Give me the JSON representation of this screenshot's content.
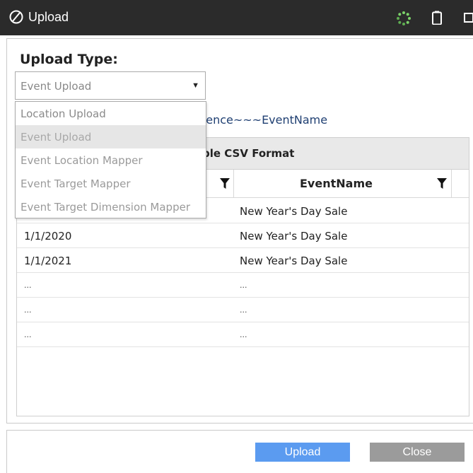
{
  "window": {
    "title": "Upload"
  },
  "form": {
    "upload_type_label": "Upload Type:",
    "selected_value": "Event Upload",
    "hint_text": "rence~~~EventName"
  },
  "dropdown": {
    "options": [
      "Location Upload",
      "Event Upload",
      "Event Location Mapper",
      "Event Target Mapper",
      "Event Target Dimension Mapper"
    ],
    "highlighted_index": 1
  },
  "table": {
    "caption": "ple CSV Format",
    "columns": [
      "",
      "EventName"
    ],
    "rows": [
      [
        "",
        "New Year's Day Sale"
      ],
      [
        "1/1/2020",
        "New Year's Day Sale"
      ],
      [
        "1/1/2021",
        "New Year's Day Sale"
      ],
      [
        "...",
        "..."
      ],
      [
        "...",
        "..."
      ],
      [
        "...",
        "..."
      ]
    ]
  },
  "footer": {
    "upload_label": "Upload",
    "close_label": "Close"
  },
  "colors": {
    "titlebar": "#2b2b2b",
    "upload_button": "#5b9bf0",
    "close_button": "#9b9b9b"
  },
  "icons": [
    "upload-logo-icon",
    "loading-spinner-icon",
    "battery-icon",
    "window-control-icon",
    "filter-icon",
    "dropdown-caret-icon"
  ]
}
